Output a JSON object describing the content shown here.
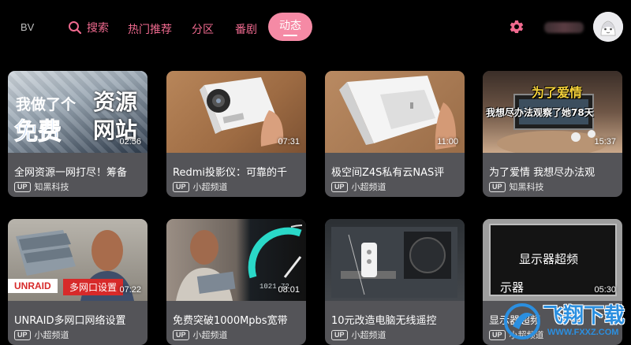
{
  "nav": {
    "logo": "BV",
    "search_label": "搜索",
    "hot_label": "热门推荐",
    "category_label": "分区",
    "bangumi_label": "番剧",
    "feed_label": "动态"
  },
  "videos": [
    {
      "title": "全网资源一网打尽！筹备",
      "uploader": "知黑科技",
      "duration": "02:56",
      "up": "UP",
      "thumb_lines": [
        "我做了个",
        "免费",
        "资源",
        "网站"
      ]
    },
    {
      "title": "Redmi投影仪：可靠的千",
      "uploader": "小超频道",
      "duration": "07:31",
      "up": "UP"
    },
    {
      "title": "极空间Z4S私有云NAS评",
      "uploader": "小超频道",
      "duration": "11:00",
      "up": "UP"
    },
    {
      "title": "为了爱情 我想尽办法观",
      "uploader": "知黑科技",
      "duration": "15:37",
      "up": "UP",
      "thumb_lines": [
        "为了爱情",
        "我想尽办法观察了她78天"
      ]
    },
    {
      "title": "UNRAID多网口网络设置",
      "uploader": "小超频道",
      "duration": "07:22",
      "up": "UP",
      "thumb_lines": [
        "UNRAID",
        "多网口设置"
      ]
    },
    {
      "title": "免费突破1000Mpbs宽带",
      "uploader": "小超频道",
      "duration": "08:01",
      "up": "UP"
    },
    {
      "title": "10元改造电脑无线遥控",
      "uploader": "小超频道",
      "duration": "",
      "up": "UP"
    },
    {
      "title": "显示器超频",
      "uploader": "小超频道",
      "duration": "05:30",
      "up": "UP",
      "thumb_lines": [
        "显示器超频",
        "示器"
      ]
    }
  ],
  "watermark": {
    "text": "飞翔下载",
    "url": "WWW.FXXZ.COM"
  },
  "colors": {
    "accent": "#f06a8f",
    "pill": "#f58aa5",
    "card": "#545458",
    "background": "#000000"
  }
}
